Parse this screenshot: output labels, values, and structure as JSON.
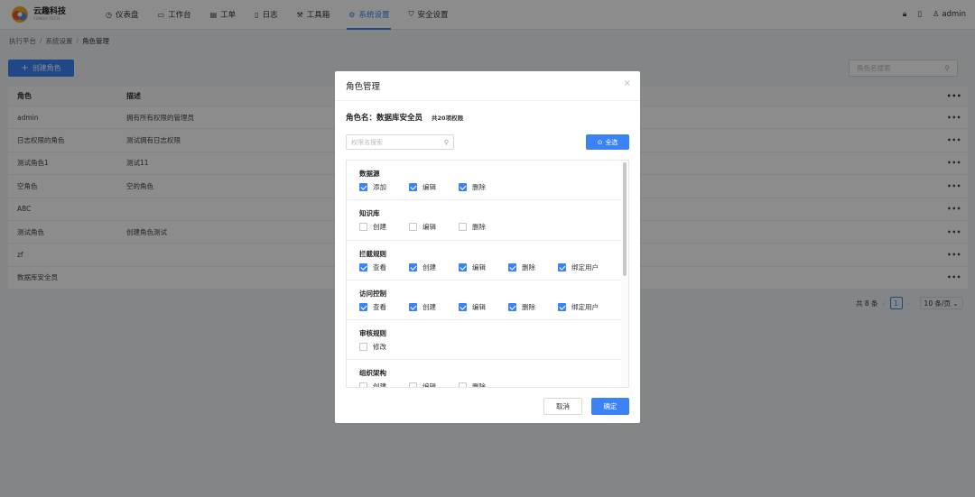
{
  "brand": {
    "name_cn": "云趣科技",
    "name_en": "YUNQU TECH"
  },
  "nav": [
    {
      "icon": "dashboard-icon",
      "glyph": "◷",
      "label": "仪表盘",
      "active": false
    },
    {
      "icon": "monitor-icon",
      "glyph": "▭",
      "label": "工作台",
      "active": false
    },
    {
      "icon": "ticket-icon",
      "glyph": "▤",
      "label": "工单",
      "active": false
    },
    {
      "icon": "log-icon",
      "glyph": "▯",
      "label": "日志",
      "active": false
    },
    {
      "icon": "tool-icon",
      "glyph": "⚒",
      "label": "工具箱",
      "active": false
    },
    {
      "icon": "settings-icon",
      "glyph": "⚙",
      "label": "系统设置",
      "active": true
    },
    {
      "icon": "shield-icon",
      "glyph": "⛉",
      "label": "安全设置",
      "active": false
    }
  ],
  "user": {
    "name": "admin"
  },
  "breadcrumb": {
    "items": [
      "执行平台",
      "系统设置"
    ],
    "current": "角色管理"
  },
  "toolbar": {
    "create_label": "创建角色",
    "search_placeholder": "角色名搜索"
  },
  "table": {
    "headers": {
      "role": "角色",
      "desc": "描述",
      "more": "•••"
    },
    "rows": [
      {
        "role": "admin",
        "desc": "拥有所有权限的管理员"
      },
      {
        "role": "日志权限的角色",
        "desc": "测试拥有日志权限"
      },
      {
        "role": "测试角色1",
        "desc": "测试11"
      },
      {
        "role": "空角色",
        "desc": "空的角色"
      },
      {
        "role": "ABC",
        "desc": ""
      },
      {
        "role": "测试角色",
        "desc": "创建角色测试"
      },
      {
        "role": "zf",
        "desc": ""
      },
      {
        "role": "数据库安全员",
        "desc": ""
      }
    ]
  },
  "pagination": {
    "total": "共 8 条",
    "page": "1",
    "size": "10 条/页"
  },
  "modal": {
    "title": "角色管理",
    "role_label": "角色名：",
    "role_name": "数据库安全员",
    "perm_count": "共20项权限",
    "search_placeholder": "权限名搜索",
    "select_all": "全选",
    "cancel": "取消",
    "confirm": "确定",
    "groups": [
      {
        "title": "数据源",
        "options": [
          {
            "label": "添加",
            "checked": true
          },
          {
            "label": "编辑",
            "checked": true
          },
          {
            "label": "删除",
            "checked": true
          }
        ]
      },
      {
        "title": "知识库",
        "options": [
          {
            "label": "创建",
            "checked": false
          },
          {
            "label": "编辑",
            "checked": false
          },
          {
            "label": "删除",
            "checked": false
          }
        ]
      },
      {
        "title": "拦截规则",
        "options": [
          {
            "label": "查看",
            "checked": true
          },
          {
            "label": "创建",
            "checked": true
          },
          {
            "label": "编辑",
            "checked": true
          },
          {
            "label": "删除",
            "checked": true
          },
          {
            "label": "绑定用户",
            "checked": true
          }
        ]
      },
      {
        "title": "访问控制",
        "options": [
          {
            "label": "查看",
            "checked": true
          },
          {
            "label": "创建",
            "checked": true
          },
          {
            "label": "编辑",
            "checked": true
          },
          {
            "label": "删除",
            "checked": true
          },
          {
            "label": "绑定用户",
            "checked": true
          }
        ]
      },
      {
        "title": "审核规则",
        "options": [
          {
            "label": "修改",
            "checked": false
          }
        ]
      },
      {
        "title": "组织架构",
        "options": [
          {
            "label": "创建",
            "checked": false
          },
          {
            "label": "编辑",
            "checked": false
          },
          {
            "label": "删除",
            "checked": false
          }
        ]
      }
    ]
  },
  "colors": {
    "primary": "#3b82f6",
    "overlay": "rgba(0,0,0,0.45)"
  }
}
